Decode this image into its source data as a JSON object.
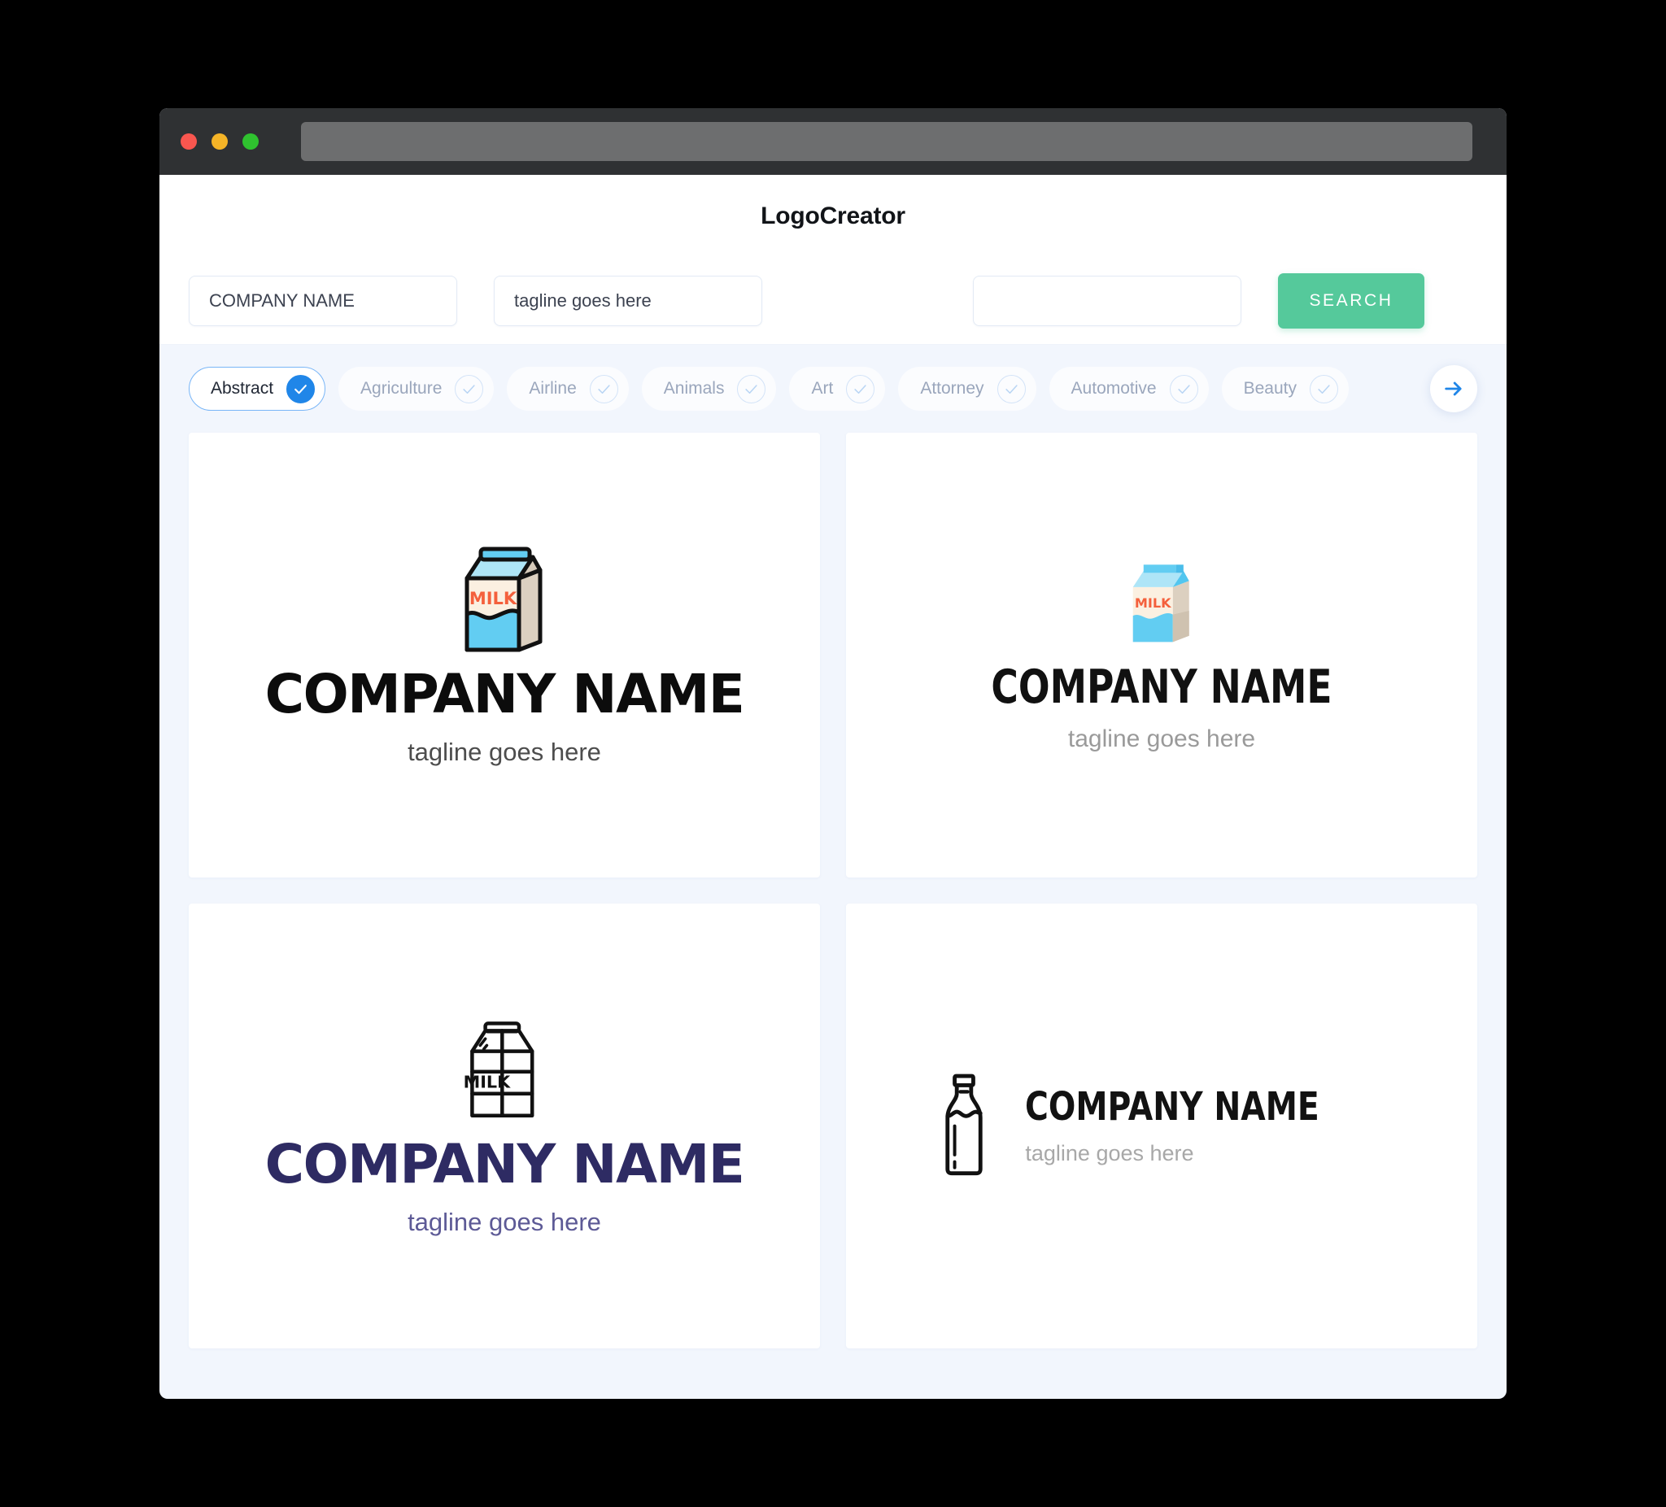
{
  "window": {
    "traffic_lights": [
      "close",
      "minimize",
      "maximize"
    ],
    "url_bar_value": ""
  },
  "header": {
    "app_title": "LogoCreator"
  },
  "search": {
    "company_name_value": "COMPANY NAME",
    "company_name_placeholder": "COMPANY NAME",
    "tagline_value": "tagline goes here",
    "tagline_placeholder": "tagline goes here",
    "keyword_value": "",
    "keyword_placeholder": "",
    "search_button_label": "SEARCH"
  },
  "categories": {
    "items": [
      {
        "label": "Abstract",
        "selected": true
      },
      {
        "label": "Agriculture",
        "selected": false
      },
      {
        "label": "Airline",
        "selected": false
      },
      {
        "label": "Animals",
        "selected": false
      },
      {
        "label": "Art",
        "selected": false
      },
      {
        "label": "Attorney",
        "selected": false
      },
      {
        "label": "Automotive",
        "selected": false
      },
      {
        "label": "Beauty",
        "selected": false
      }
    ],
    "next_label": "next"
  },
  "results": {
    "cards": [
      {
        "icon": "milk-carton-outlined-color",
        "icon_label": "MILK",
        "name": "COMPANY NAME",
        "tagline": "tagline goes here",
        "name_color": "#0C0C0C",
        "tagline_color": "#4D4D4D",
        "layout": "stacked"
      },
      {
        "icon": "milk-carton-flat-color",
        "icon_label": "MILK",
        "name": "COMPANY NAME",
        "tagline": "tagline goes here",
        "name_color": "#111111",
        "tagline_color": "#9A9A9A",
        "layout": "stacked"
      },
      {
        "icon": "milk-carton-lineart",
        "icon_label": "MILK",
        "name": "COMPANY NAME",
        "tagline": "tagline goes here",
        "name_color": "#2E2B63",
        "tagline_color": "#5D5A96",
        "layout": "stacked"
      },
      {
        "icon": "milk-bottle-lineart",
        "icon_label": "",
        "name": "COMPANY NAME",
        "tagline": "tagline goes here",
        "name_color": "#121212",
        "tagline_color": "#A8A8A8",
        "layout": "horizontal"
      }
    ]
  },
  "colors": {
    "page_background": "#F2F6FD",
    "card_background": "#FFFFFF",
    "search_button": "#55C99B",
    "selected_pill_accent": "#2086E8",
    "chrome": "#2F3133",
    "milk_blue": "#62CDF2",
    "milk_cream": "#FBF0E1",
    "milk_beige": "#DCD0C0",
    "milk_orange": "#F4603C"
  }
}
